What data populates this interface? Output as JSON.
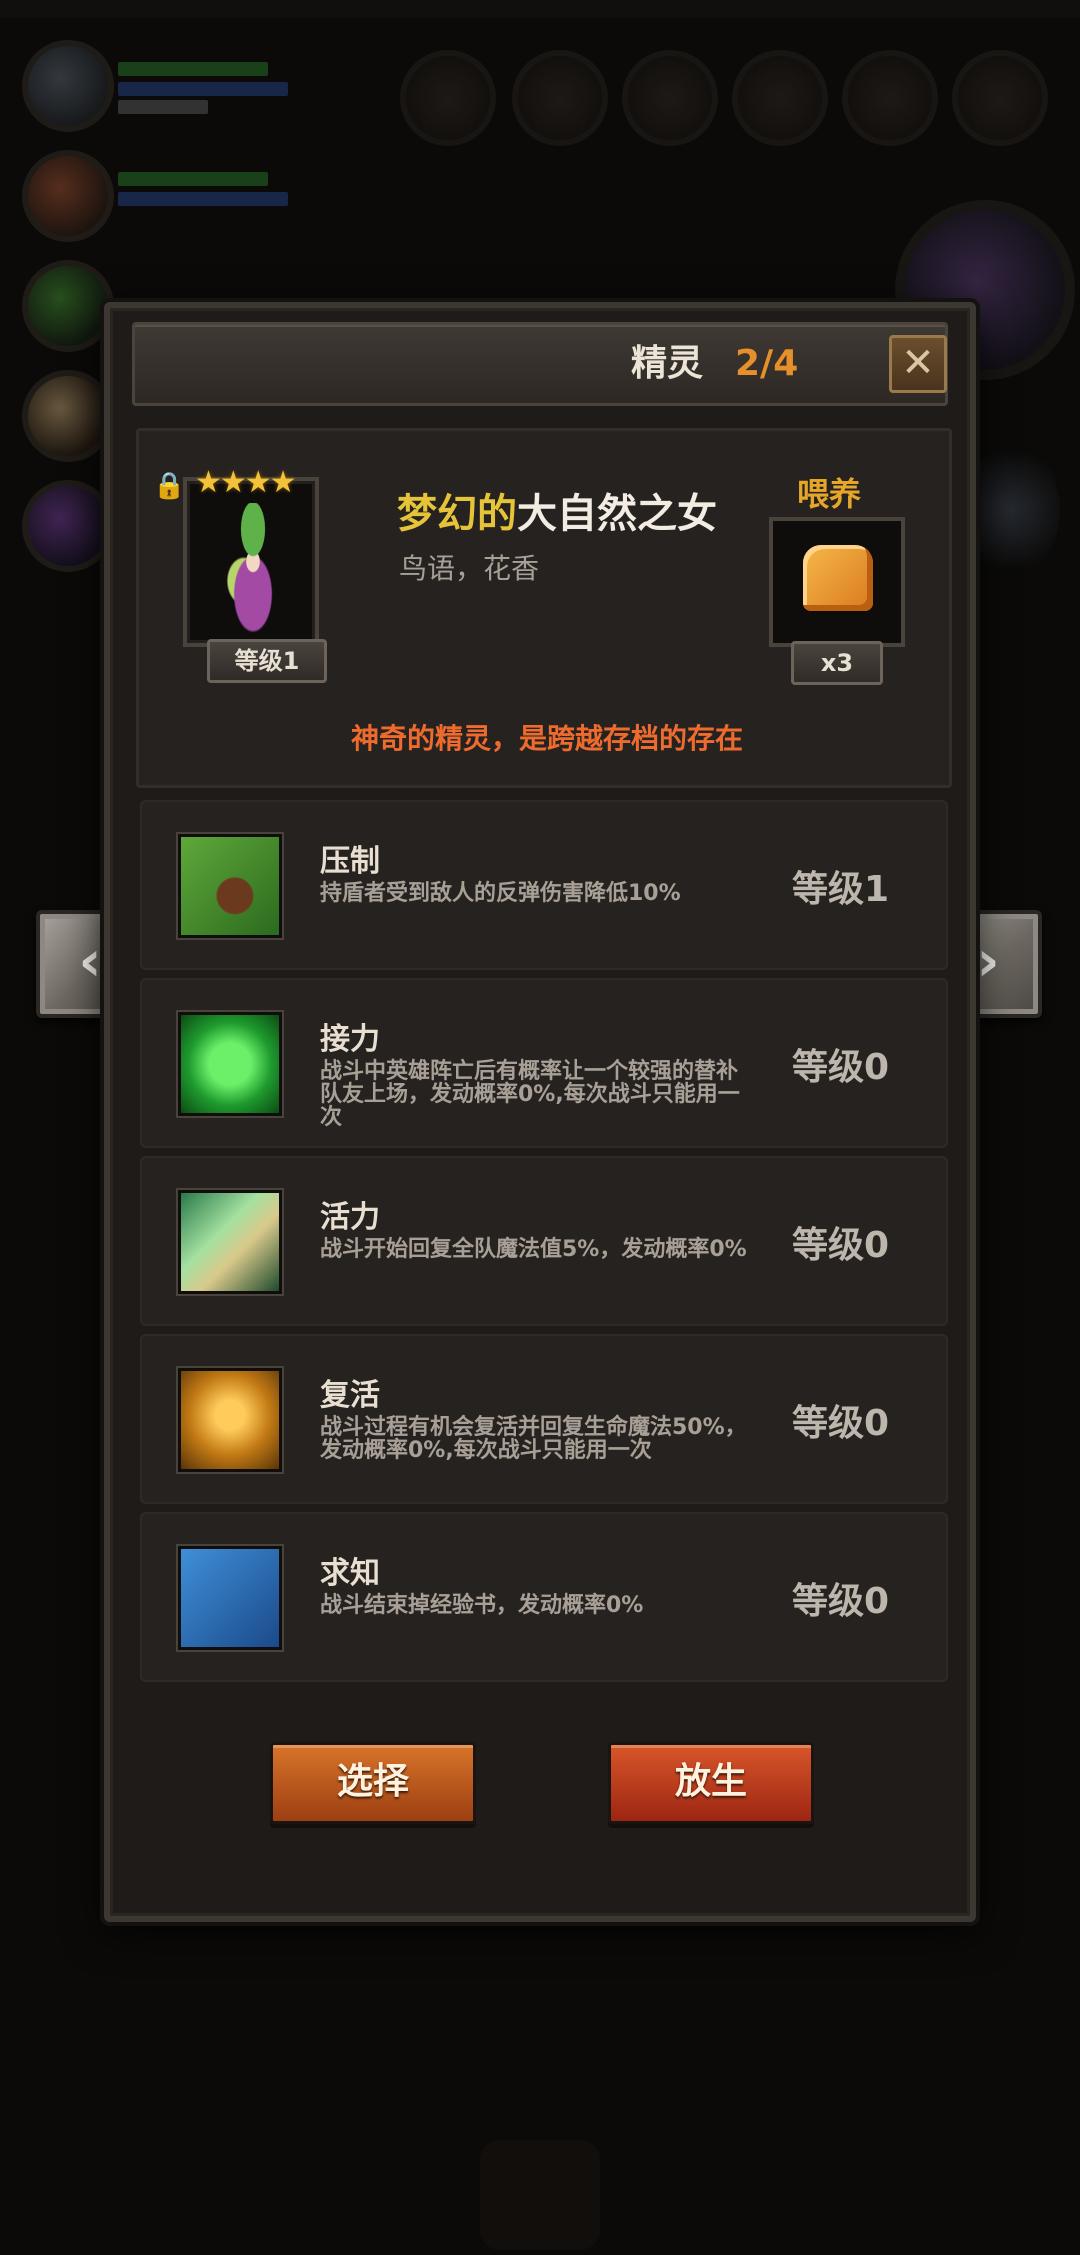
{
  "dialog": {
    "title": "精灵",
    "page": "2/4",
    "close_symbol": "✕"
  },
  "spirit": {
    "stars": "★★★★",
    "star_count": 4,
    "name_adjective": "梦幻的",
    "name_noun": "大自然之女",
    "subtitle": "鸟语，花香",
    "level_label": "等级1",
    "description": "神奇的精灵，是跨越存档的存在",
    "locked_icon": "lock-icon"
  },
  "feed": {
    "label": "喂养",
    "item_icon": "bread-icon",
    "count": "x3"
  },
  "skills": [
    {
      "name": "压制",
      "desc": "持盾者受到敌人的反弹伤害降低10%",
      "level": "等级1",
      "icon": "claw-skill-icon"
    },
    {
      "name": "接力",
      "desc": "战斗中英雄阵亡后有概率让一个较强的替补队友上场，发动概率0%,每次战斗只能用一次",
      "level": "等级0",
      "icon": "hands-skill-icon"
    },
    {
      "name": "活力",
      "desc": "战斗开始回复全队魔法值5%，发动概率0%",
      "level": "等级0",
      "icon": "praying-skill-icon"
    },
    {
      "name": "复活",
      "desc": "战斗过程有机会复活并回复生命魔法50%，发动概率0%,每次战斗只能用一次",
      "level": "等级0",
      "icon": "revive-skill-icon"
    },
    {
      "name": "求知",
      "desc": "战斗结束掉经验书，发动概率0%",
      "level": "等级0",
      "icon": "book-skill-icon"
    }
  ],
  "buttons": {
    "select": "选择",
    "release": "放生"
  },
  "nav": {
    "prev": "‹",
    "next": "›"
  },
  "colors": {
    "accent_orange": "#e5902a",
    "name_gold": "#e6c43a",
    "desc_red": "#ee6b2e"
  }
}
